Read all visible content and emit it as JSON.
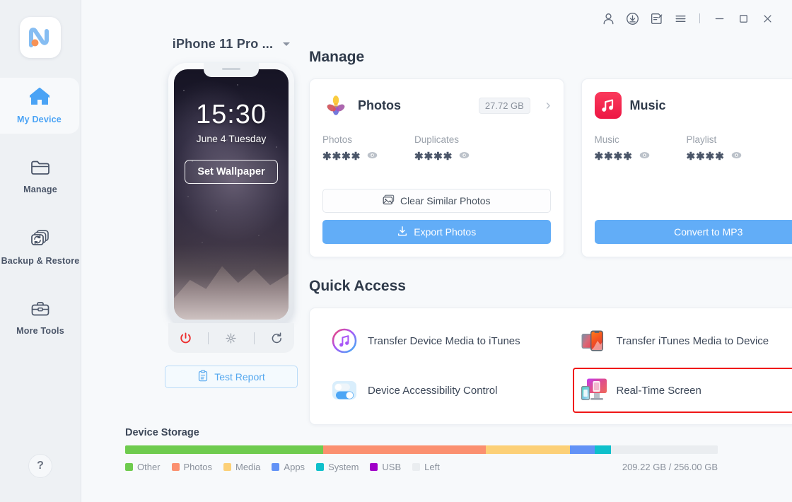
{
  "titlebar": {
    "buttons": [
      {
        "name": "account-icon",
        "label": "Account"
      },
      {
        "name": "download-icon",
        "label": "Downloads"
      },
      {
        "name": "feedback-icon",
        "label": "Feedback"
      },
      {
        "name": "menu-icon",
        "label": "Menu"
      }
    ],
    "minimize": "–",
    "maximize": "□",
    "close": "×"
  },
  "sidebar": {
    "logo": "logo-icon",
    "items": [
      {
        "label": "My Device",
        "icon": "home-icon",
        "active": true
      },
      {
        "label": "Manage",
        "icon": "folder-icon",
        "active": false
      },
      {
        "label": "Backup & Restore",
        "icon": "backup-restore-icon",
        "active": false
      },
      {
        "label": "More Tools",
        "icon": "toolbox-icon",
        "active": false
      }
    ],
    "help": "?"
  },
  "device": {
    "name": "iPhone 11 Pro ...",
    "lock_time": "15:30",
    "lock_date": "June 4 Tuesday",
    "set_wallpaper": "Set Wallpaper",
    "controls": [
      {
        "name": "power-icon",
        "label": "Power"
      },
      {
        "name": "refresh-screen-icon",
        "label": "Refresh Screen"
      },
      {
        "name": "reload-icon",
        "label": "Reload"
      }
    ],
    "test_report": "Test Report"
  },
  "manage": {
    "title": "Manage",
    "edit_icon": "pencil-icon",
    "cards": [
      {
        "name": "Photos",
        "icon": "photos-app-icon",
        "size": "27.72 GB",
        "chevron": "›",
        "stats": [
          {
            "label": "Photos",
            "value": "✱✱✱✱"
          },
          {
            "label": "Duplicates",
            "value": "✱✱✱✱"
          }
        ],
        "outline_button": "Clear Similar Photos",
        "outline_icon": "photos-stack-icon",
        "primary_button": "Export Photos",
        "primary_icon": "download-tray-icon"
      },
      {
        "name": "Music",
        "icon": "music-app-icon",
        "size": "",
        "chevron": "›",
        "stats": [
          {
            "label": "Music",
            "value": "✱✱✱✱"
          },
          {
            "label": "Playlist",
            "value": "✱✱✱✱"
          }
        ],
        "outline_button": "",
        "primary_button": "Convert to MP3"
      }
    ]
  },
  "quick_access": {
    "title": "Quick Access",
    "edit_icon": "pencil-icon",
    "items": [
      {
        "label": "Transfer Device Media to iTunes",
        "icon": "itunes-icon",
        "highlighted": false
      },
      {
        "label": "Transfer iTunes Media to Device",
        "icon": "two-phones-icon",
        "highlighted": false
      },
      {
        "label": "Device Accessibility Control",
        "icon": "toggle-switches-icon",
        "highlighted": false
      },
      {
        "label": "Real-Time Screen",
        "icon": "screen-mirror-icon",
        "highlighted": true
      }
    ]
  },
  "storage": {
    "title": "Device Storage",
    "total_text": "209.22 GB / 256.00 GB",
    "clean_icon": "broom-icon",
    "legend": [
      {
        "label": "Other",
        "color": "#6ecb4e"
      },
      {
        "label": "Photos",
        "color": "#fb9070"
      },
      {
        "label": "Media",
        "color": "#fcd077"
      },
      {
        "label": "Apps",
        "color": "#6292f6"
      },
      {
        "label": "System",
        "color": "#0fc0cb"
      },
      {
        "label": "USB",
        "color": "#a000c8"
      },
      {
        "label": "Left",
        "color": "#eaedf0"
      }
    ],
    "chart_data": {
      "type": "bar",
      "title": "Device Storage",
      "categories": [
        "Other",
        "Photos",
        "Media",
        "Apps",
        "System",
        "USB",
        "Left"
      ],
      "values": [
        33.4,
        27.7,
        14.1,
        4.2,
        2.8,
        0,
        46.8
      ],
      "unit": "GB",
      "total": 256.0,
      "used": 209.22,
      "segment_percent": [
        33.4,
        27.5,
        14.1,
        4.2,
        2.8,
        0.0,
        18.0
      ]
    }
  },
  "colors": {
    "accent": "#62adf7",
    "highlight": "#f01616",
    "sidebar_bg": "#eef1f4",
    "page_bg": "#f7f9fb"
  }
}
